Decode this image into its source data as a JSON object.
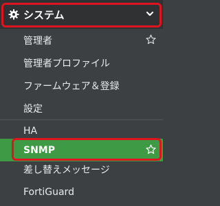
{
  "section": {
    "label": "システム",
    "icon": "gear-icon",
    "expand_icon": "chevron-down-icon"
  },
  "items": [
    {
      "label": "管理者",
      "favorite_icon": "star-outline-icon"
    },
    {
      "label": "管理者プロファイル"
    },
    {
      "label": "ファームウェア＆登録"
    },
    {
      "label": "設定"
    },
    {
      "label": "HA"
    },
    {
      "label": "SNMP",
      "active": true,
      "favorite_icon": "star-outline-icon"
    },
    {
      "label": "差し替えメッセージ"
    },
    {
      "label": "FortiGuard"
    }
  ],
  "colors": {
    "sidebar_bg": "#3c4043",
    "header_bg": "#2f3133",
    "active_bg": "#3f9a45",
    "highlight_border": "#e0141e",
    "text": "#e9eaeb"
  }
}
